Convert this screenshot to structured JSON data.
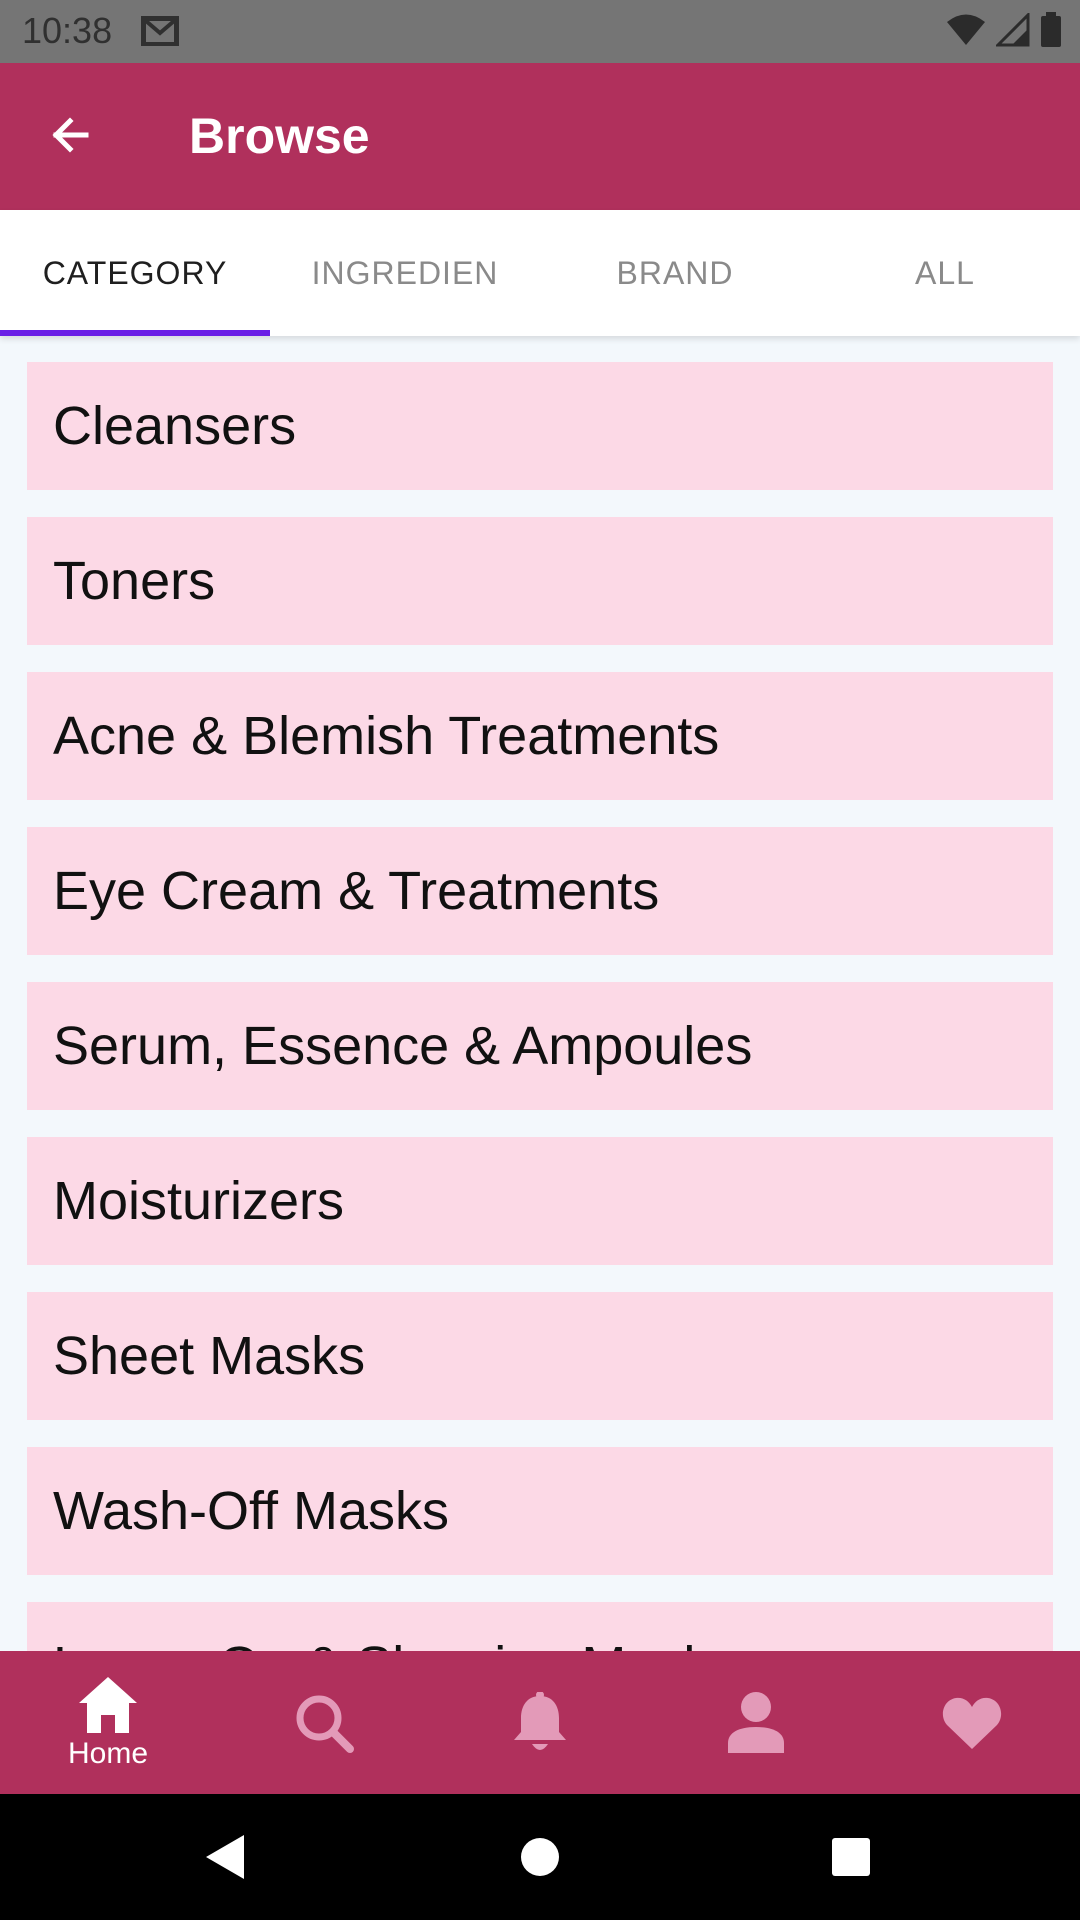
{
  "status_bar": {
    "time": "10:38"
  },
  "app_bar": {
    "title": "Browse",
    "back_icon": "arrow-back-icon"
  },
  "tabs": [
    {
      "label": "CATEGORY",
      "active": true
    },
    {
      "label": "INGREDIEN",
      "active": false
    },
    {
      "label": "BRAND",
      "active": false
    },
    {
      "label": "ALL",
      "active": false
    }
  ],
  "categories": [
    "Cleansers",
    "Toners",
    "Acne & Blemish Treatments",
    "Eye Cream & Treatments",
    "Serum, Essence & Ampoules",
    "Moisturizers",
    "Sheet Masks",
    "Wash-Off Masks",
    "Leave-On & Sleeping Masks"
  ],
  "bottom_nav": [
    {
      "label": "Home",
      "icon": "home-icon",
      "active": true
    },
    {
      "label": "",
      "icon": "search-icon",
      "active": false
    },
    {
      "label": "",
      "icon": "bell-icon",
      "active": false
    },
    {
      "label": "",
      "icon": "person-icon",
      "active": false
    },
    {
      "label": "",
      "icon": "heart-icon",
      "active": false
    }
  ],
  "colors": {
    "primary": "#b0305c",
    "item_background": "#fcd9e6",
    "tab_indicator": "#6a1fe6",
    "inactive_icon": "#e39ab8"
  }
}
